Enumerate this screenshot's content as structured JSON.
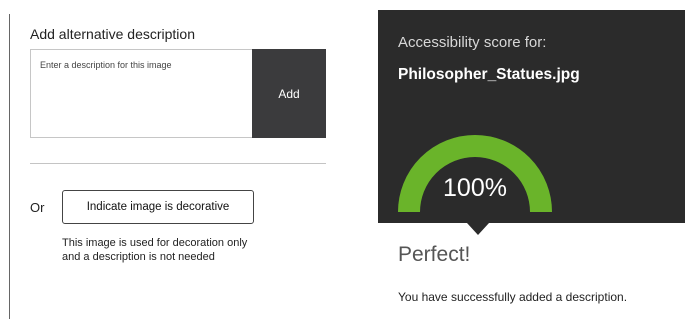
{
  "alt_text_form": {
    "heading": "Add alternative description",
    "placeholder": "Enter a description for this image",
    "value": "",
    "add_label": "Add"
  },
  "decorative": {
    "or_label": "Or",
    "button_label": "Indicate image is decorative",
    "help_text": "This image is used for decoration only and a description is not needed"
  },
  "score": {
    "label": "Accessibility score for:",
    "filename": "Philosopher_Statues.jpg",
    "value_text": "100%",
    "value_fraction": 1.0,
    "gauge_color": "#6ab42a",
    "panel_color": "#2b2b2b"
  },
  "result": {
    "heading": "Perfect!",
    "message": "You have successfully added a description."
  }
}
